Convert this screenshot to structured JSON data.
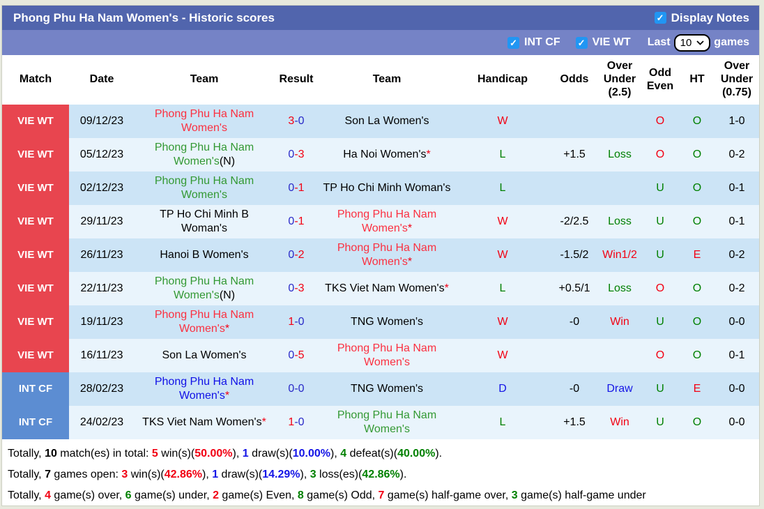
{
  "palette": {
    "red": "#f20013",
    "green": "#008000",
    "team_red": "#fb3040",
    "team_green": "#339933",
    "team_blue": "#1010e6",
    "result_blue": "#2a2ac8",
    "draw_blue": "#1515e6",
    "black": "#000000",
    "badge_red": "#e8454f",
    "badge_blue": "#5c8dd2",
    "bar1": "#5165ad",
    "bar2": "#7583c6",
    "row_dark": "#cce4f6",
    "row_light": "#e9f4fc",
    "checkbox_blue": "#2196f3"
  },
  "header": {
    "title": "Phong Phu Ha Nam Women's - Historic scores",
    "display_notes_label": "Display Notes",
    "filters": {
      "int_cf_label": "INT CF",
      "vie_wt_label": "VIE WT",
      "last_label": "Last",
      "last_value": "10",
      "games_label": "games"
    }
  },
  "table": {
    "columns": [
      "Match",
      "Date",
      "Team",
      "Result",
      "Team",
      "Handicap",
      "Odds",
      "Over Under (2.5)",
      "Odd Even",
      "HT",
      "Over Under (0.75)"
    ],
    "rows": [
      {
        "league": "VIE WT",
        "league_color": "badge_red",
        "date": "09/12/23",
        "team1": {
          "name": "Phong Phu Ha Nam Women's",
          "suffix": "",
          "star": false,
          "color": "team_red"
        },
        "score": {
          "home": "3",
          "away": "0",
          "home_color": "red",
          "away_color": "result_blue"
        },
        "team2": {
          "name": "Son La Women's",
          "suffix": "",
          "star": false,
          "color": "black"
        },
        "wdl": {
          "text": "W",
          "color": "red"
        },
        "handicap": "",
        "odds": {
          "text": "",
          "color": "black"
        },
        "ou25": {
          "text": "O",
          "color": "red"
        },
        "oddeven": {
          "text": "O",
          "color": "green"
        },
        "ht": "1-0",
        "ou075": {
          "text": "O",
          "color": "red"
        }
      },
      {
        "league": "VIE WT",
        "league_color": "badge_red",
        "date": "05/12/23",
        "team1": {
          "name": "Phong Phu Ha Nam Women's",
          "suffix": "(N)",
          "star": false,
          "color": "team_green"
        },
        "score": {
          "home": "0",
          "away": "3",
          "home_color": "result_blue",
          "away_color": "red"
        },
        "team2": {
          "name": "Ha Noi Women's",
          "suffix": "",
          "star": true,
          "color": "black"
        },
        "wdl": {
          "text": "L",
          "color": "green"
        },
        "handicap": "+1.5",
        "odds": {
          "text": "Loss",
          "color": "green"
        },
        "ou25": {
          "text": "O",
          "color": "red"
        },
        "oddeven": {
          "text": "O",
          "color": "green"
        },
        "ht": "0-2",
        "ou075": {
          "text": "O",
          "color": "red"
        }
      },
      {
        "league": "VIE WT",
        "league_color": "badge_red",
        "date": "02/12/23",
        "team1": {
          "name": "Phong Phu Ha Nam Women's",
          "suffix": "",
          "star": false,
          "color": "team_green"
        },
        "score": {
          "home": "0",
          "away": "1",
          "home_color": "result_blue",
          "away_color": "red"
        },
        "team2": {
          "name": "TP Ho Chi Minh Woman's",
          "suffix": "",
          "star": false,
          "color": "black"
        },
        "wdl": {
          "text": "L",
          "color": "green"
        },
        "handicap": "",
        "odds": {
          "text": "",
          "color": "black"
        },
        "ou25": {
          "text": "U",
          "color": "green"
        },
        "oddeven": {
          "text": "O",
          "color": "green"
        },
        "ht": "0-1",
        "ou075": {
          "text": "O",
          "color": "red"
        }
      },
      {
        "league": "VIE WT",
        "league_color": "badge_red",
        "date": "29/11/23",
        "team1": {
          "name": "TP Ho Chi Minh B Woman's",
          "suffix": "",
          "star": false,
          "color": "black"
        },
        "score": {
          "home": "0",
          "away": "1",
          "home_color": "result_blue",
          "away_color": "red"
        },
        "team2": {
          "name": "Phong Phu Ha Nam Women's",
          "suffix": "",
          "star": true,
          "color": "team_red"
        },
        "wdl": {
          "text": "W",
          "color": "red"
        },
        "handicap": "-2/2.5",
        "odds": {
          "text": "Loss",
          "color": "green"
        },
        "ou25": {
          "text": "U",
          "color": "green"
        },
        "oddeven": {
          "text": "O",
          "color": "green"
        },
        "ht": "0-1",
        "ou075": {
          "text": "O",
          "color": "red"
        }
      },
      {
        "league": "VIE WT",
        "league_color": "badge_red",
        "date": "26/11/23",
        "team1": {
          "name": "Hanoi B Women's",
          "suffix": "",
          "star": false,
          "color": "black"
        },
        "score": {
          "home": "0",
          "away": "2",
          "home_color": "result_blue",
          "away_color": "red"
        },
        "team2": {
          "name": "Phong Phu Ha Nam Women's",
          "suffix": "",
          "star": true,
          "color": "team_red"
        },
        "wdl": {
          "text": "W",
          "color": "red"
        },
        "handicap": "-1.5/2",
        "odds": {
          "text": "Win1/2",
          "color": "red"
        },
        "ou25": {
          "text": "U",
          "color": "green"
        },
        "oddeven": {
          "text": "E",
          "color": "red"
        },
        "ht": "0-2",
        "ou075": {
          "text": "O",
          "color": "red"
        }
      },
      {
        "league": "VIE WT",
        "league_color": "badge_red",
        "date": "22/11/23",
        "team1": {
          "name": "Phong Phu Ha Nam Women's",
          "suffix": "(N)",
          "star": false,
          "color": "team_green"
        },
        "score": {
          "home": "0",
          "away": "3",
          "home_color": "result_blue",
          "away_color": "red"
        },
        "team2": {
          "name": "TKS Viet Nam Women's",
          "suffix": "",
          "star": true,
          "color": "black"
        },
        "wdl": {
          "text": "L",
          "color": "green"
        },
        "handicap": "+0.5/1",
        "odds": {
          "text": "Loss",
          "color": "green"
        },
        "ou25": {
          "text": "O",
          "color": "red"
        },
        "oddeven": {
          "text": "O",
          "color": "green"
        },
        "ht": "0-2",
        "ou075": {
          "text": "O",
          "color": "red"
        }
      },
      {
        "league": "VIE WT",
        "league_color": "badge_red",
        "date": "19/11/23",
        "team1": {
          "name": "Phong Phu Ha Nam Women's",
          "suffix": "",
          "star": true,
          "color": "team_red"
        },
        "score": {
          "home": "1",
          "away": "0",
          "home_color": "red",
          "away_color": "result_blue"
        },
        "team2": {
          "name": "TNG Women's",
          "suffix": "",
          "star": false,
          "color": "black"
        },
        "wdl": {
          "text": "W",
          "color": "red"
        },
        "handicap": "-0",
        "odds": {
          "text": "Win",
          "color": "red"
        },
        "ou25": {
          "text": "U",
          "color": "green"
        },
        "oddeven": {
          "text": "O",
          "color": "green"
        },
        "ht": "0-0",
        "ou075": {
          "text": "U",
          "color": "green"
        }
      },
      {
        "league": "VIE WT",
        "league_color": "badge_red",
        "date": "16/11/23",
        "team1": {
          "name": "Son La Women's",
          "suffix": "",
          "star": false,
          "color": "black"
        },
        "score": {
          "home": "0",
          "away": "5",
          "home_color": "result_blue",
          "away_color": "red"
        },
        "team2": {
          "name": "Phong Phu Ha Nam Women's",
          "suffix": "",
          "star": false,
          "color": "team_red"
        },
        "wdl": {
          "text": "W",
          "color": "red"
        },
        "handicap": "",
        "odds": {
          "text": "",
          "color": "black"
        },
        "ou25": {
          "text": "O",
          "color": "red"
        },
        "oddeven": {
          "text": "O",
          "color": "green"
        },
        "ht": "0-1",
        "ou075": {
          "text": "O",
          "color": "red"
        }
      },
      {
        "league": "INT CF",
        "league_color": "badge_blue",
        "date": "28/02/23",
        "team1": {
          "name": "Phong Phu Ha Nam Women's",
          "suffix": "",
          "star": true,
          "color": "team_blue"
        },
        "score": {
          "home": "0",
          "away": "0",
          "home_color": "result_blue",
          "away_color": "result_blue"
        },
        "team2": {
          "name": "TNG Women's",
          "suffix": "",
          "star": false,
          "color": "black"
        },
        "wdl": {
          "text": "D",
          "color": "draw_blue"
        },
        "handicap": "-0",
        "odds": {
          "text": "Draw",
          "color": "draw_blue"
        },
        "ou25": {
          "text": "U",
          "color": "green"
        },
        "oddeven": {
          "text": "E",
          "color": "red"
        },
        "ht": "0-0",
        "ou075": {
          "text": "U",
          "color": "green"
        }
      },
      {
        "league": "INT CF",
        "league_color": "badge_blue",
        "date": "24/02/23",
        "team1": {
          "name": "TKS Viet Nam Women's",
          "suffix": "",
          "star": true,
          "color": "black"
        },
        "score": {
          "home": "1",
          "away": "0",
          "home_color": "red",
          "away_color": "result_blue"
        },
        "team2": {
          "name": "Phong Phu Ha Nam Women's",
          "suffix": "",
          "star": false,
          "color": "team_green"
        },
        "wdl": {
          "text": "L",
          "color": "green"
        },
        "handicap": "+1.5",
        "odds": {
          "text": "Win",
          "color": "red"
        },
        "ou25": {
          "text": "U",
          "color": "green"
        },
        "oddeven": {
          "text": "O",
          "color": "green"
        },
        "ht": "0-0",
        "ou075": {
          "text": "U",
          "color": "green"
        }
      }
    ]
  },
  "summary": [
    [
      {
        "text": "Totally, ",
        "color": "black",
        "bold": false
      },
      {
        "text": "10",
        "color": "black",
        "bold": true
      },
      {
        "text": " match(es) in total: ",
        "color": "black",
        "bold": false
      },
      {
        "text": "5",
        "color": "red",
        "bold": true
      },
      {
        "text": " win(s)(",
        "color": "black",
        "bold": false
      },
      {
        "text": "50.00%",
        "color": "red",
        "bold": true
      },
      {
        "text": "), ",
        "color": "black",
        "bold": false
      },
      {
        "text": "1",
        "color": "draw_blue",
        "bold": true
      },
      {
        "text": " draw(s)(",
        "color": "black",
        "bold": false
      },
      {
        "text": "10.00%",
        "color": "draw_blue",
        "bold": true
      },
      {
        "text": "), ",
        "color": "black",
        "bold": false
      },
      {
        "text": "4",
        "color": "green",
        "bold": true
      },
      {
        "text": " defeat(s)(",
        "color": "black",
        "bold": false
      },
      {
        "text": "40.00%",
        "color": "green",
        "bold": true
      },
      {
        "text": ").",
        "color": "black",
        "bold": false
      }
    ],
    [
      {
        "text": "Totally, ",
        "color": "black",
        "bold": false
      },
      {
        "text": "7",
        "color": "black",
        "bold": true
      },
      {
        "text": " games open: ",
        "color": "black",
        "bold": false
      },
      {
        "text": "3",
        "color": "red",
        "bold": true
      },
      {
        "text": " win(s)(",
        "color": "black",
        "bold": false
      },
      {
        "text": "42.86%",
        "color": "red",
        "bold": true
      },
      {
        "text": "), ",
        "color": "black",
        "bold": false
      },
      {
        "text": "1",
        "color": "draw_blue",
        "bold": true
      },
      {
        "text": " draw(s)(",
        "color": "black",
        "bold": false
      },
      {
        "text": "14.29%",
        "color": "draw_blue",
        "bold": true
      },
      {
        "text": "), ",
        "color": "black",
        "bold": false
      },
      {
        "text": "3",
        "color": "green",
        "bold": true
      },
      {
        "text": " loss(es)(",
        "color": "black",
        "bold": false
      },
      {
        "text": "42.86%",
        "color": "green",
        "bold": true
      },
      {
        "text": ").",
        "color": "black",
        "bold": false
      }
    ],
    [
      {
        "text": "Totally, ",
        "color": "black",
        "bold": false
      },
      {
        "text": "4",
        "color": "red",
        "bold": true
      },
      {
        "text": " game(s) over, ",
        "color": "black",
        "bold": false
      },
      {
        "text": "6",
        "color": "green",
        "bold": true
      },
      {
        "text": " game(s) under, ",
        "color": "black",
        "bold": false
      },
      {
        "text": "2",
        "color": "red",
        "bold": true
      },
      {
        "text": " game(s) Even, ",
        "color": "black",
        "bold": false
      },
      {
        "text": "8",
        "color": "green",
        "bold": true
      },
      {
        "text": " game(s) Odd, ",
        "color": "black",
        "bold": false
      },
      {
        "text": "7",
        "color": "red",
        "bold": true
      },
      {
        "text": " game(s) half-game over, ",
        "color": "black",
        "bold": false
      },
      {
        "text": "3",
        "color": "green",
        "bold": true
      },
      {
        "text": " game(s) half-game under",
        "color": "black",
        "bold": false
      }
    ]
  ]
}
